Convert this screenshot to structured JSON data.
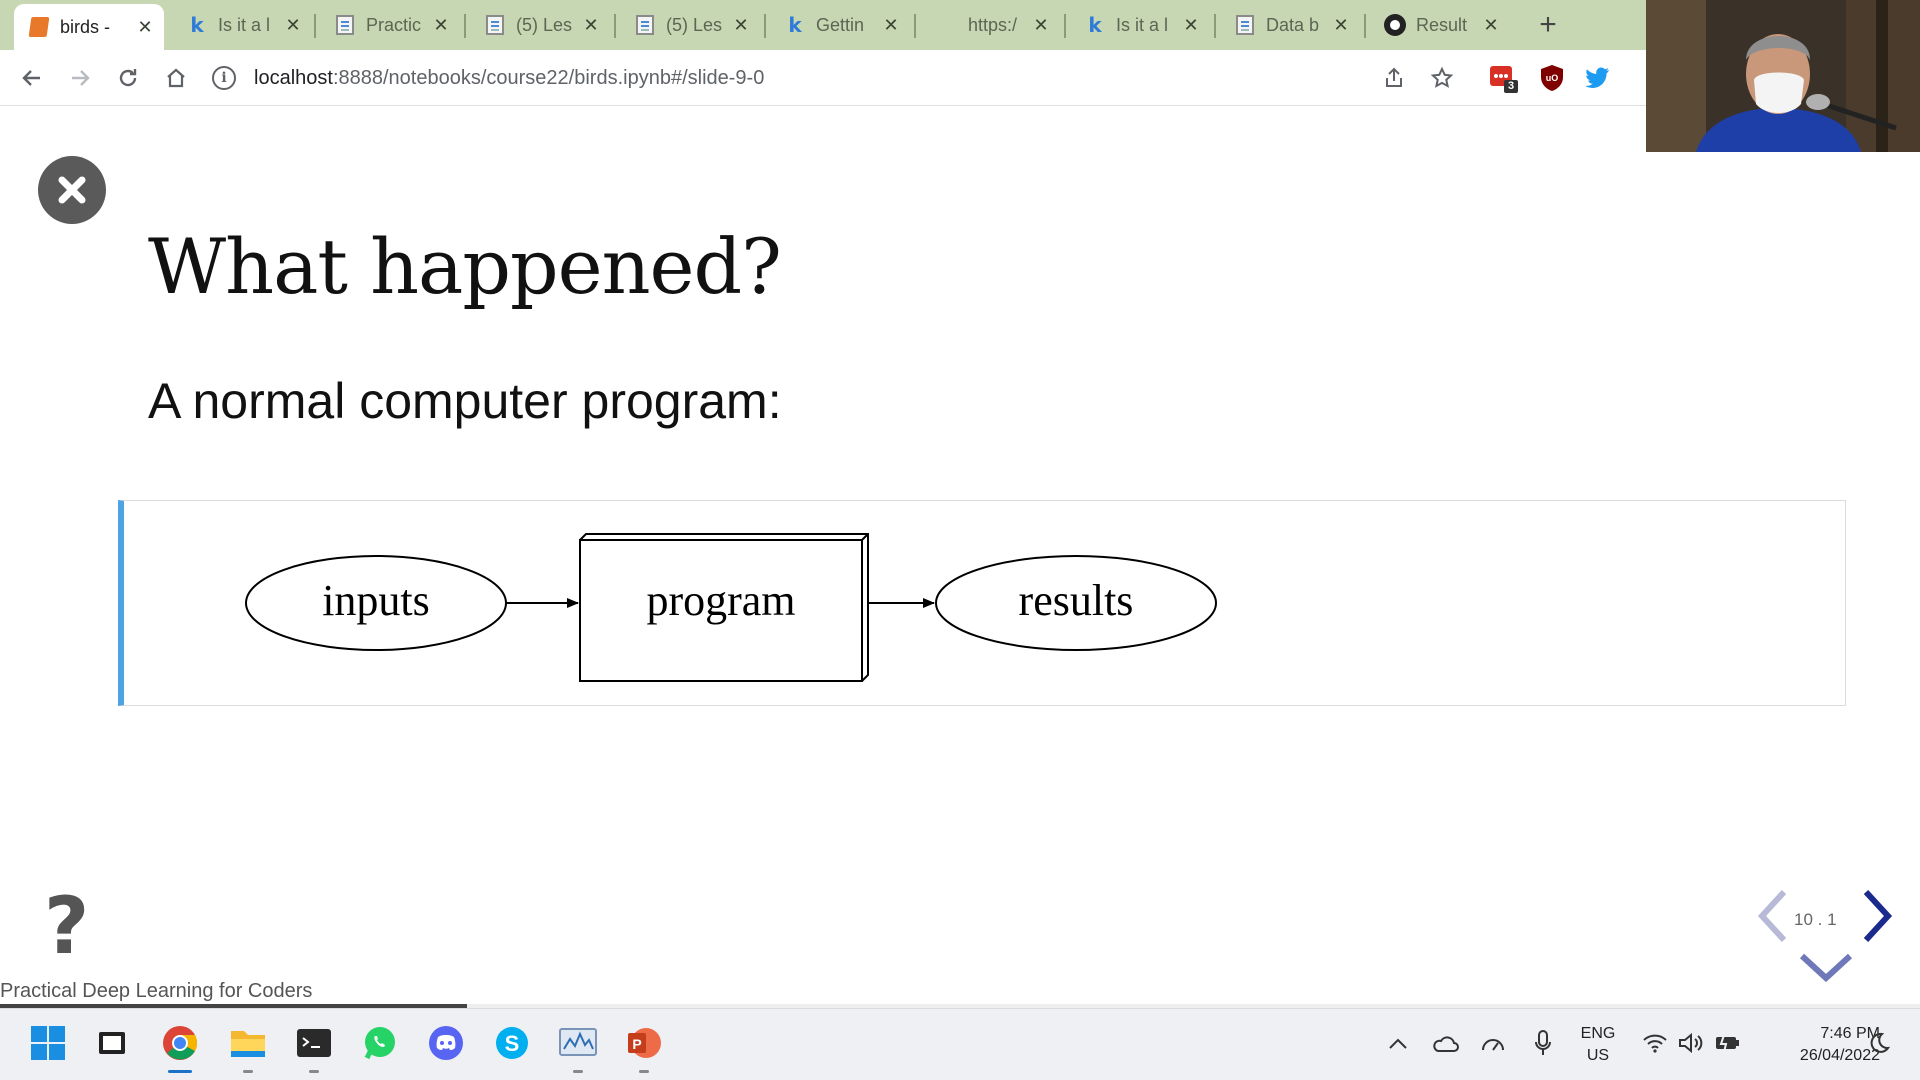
{
  "browser": {
    "tabs": [
      {
        "title": "birds -",
        "icon": "book-icon",
        "active": true
      },
      {
        "title": "Is it a l",
        "icon": "kaggle-icon"
      },
      {
        "title": "Practic",
        "icon": "document-icon"
      },
      {
        "title": "(5) Les",
        "icon": "document-icon"
      },
      {
        "title": "(5) Les",
        "icon": "document-icon"
      },
      {
        "title": "Gettin",
        "icon": "kaggle-icon"
      },
      {
        "title": "https:/",
        "icon": ""
      },
      {
        "title": "Is it a l",
        "icon": "kaggle-icon"
      },
      {
        "title": "Data b",
        "icon": "document-icon"
      },
      {
        "title": "Result",
        "icon": "github-icon"
      }
    ],
    "url_host": "localhost",
    "url_path": ":8888/notebooks/course22/birds.ipynb#/slide-9-0",
    "extension_badge": "3"
  },
  "slide": {
    "title": "What happened?",
    "subtitle": "A normal computer program:",
    "diagram": {
      "nodes": [
        {
          "label": "inputs",
          "shape": "ellipse"
        },
        {
          "label": "program",
          "shape": "box3d"
        },
        {
          "label": "results",
          "shape": "ellipse"
        }
      ]
    },
    "help": "?",
    "footer": "Practical Deep Learning for Coders",
    "slide_number": "10 . 1",
    "progress": 0.243
  },
  "taskbar": {
    "apps": [
      "start-icon",
      "desktop-icon",
      "chrome-icon",
      "file-explorer-icon",
      "terminal-icon",
      "whatsapp-icon",
      "discord-icon",
      "skype-icon",
      "monitor-icon",
      "powerpoint-icon"
    ],
    "lang_line1": "ENG",
    "lang_line2": "US",
    "time": "7:46 PM",
    "date": "26/04/2022"
  },
  "colors": {
    "tabbar": "#c7d7b3",
    "accent_border": "#4ea3e3",
    "nav_arrow": "#1b2a8c"
  }
}
